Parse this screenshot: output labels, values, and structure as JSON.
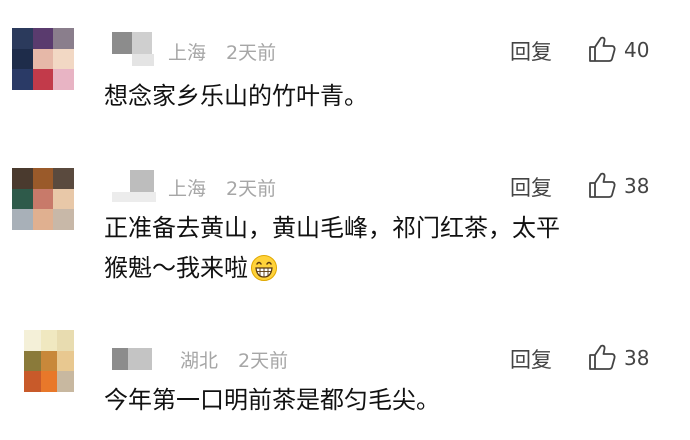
{
  "comments": [
    {
      "location": "上海",
      "time": "2天前",
      "reply_label": "回复",
      "likes": "40",
      "text": "想念家乡乐山的竹叶青。",
      "avatar_colors": [
        "#2b3a5c",
        "#5a3b6e",
        "#8a7e8c",
        "#1e2c4a",
        "#e6b8a8",
        "#f2d8c4",
        "#2a3a66",
        "#c23a4a",
        "#e8b4c4"
      ]
    },
    {
      "location": "上海",
      "time": "2天前",
      "reply_label": "回复",
      "likes": "38",
      "text_line1": "正准备去黄山，黄山毛峰，祁门红茶，太平",
      "text_line2": "猴魁～我来啦",
      "emoji": "grinning-face",
      "avatar_colors": [
        "#4a3a2e",
        "#9a5a2a",
        "#5a4a3e",
        "#2e5a4a",
        "#c87a6a",
        "#e8c8a8",
        "#a8b0b8",
        "#e0b090",
        "#c8b8a8"
      ]
    },
    {
      "location": "湖北",
      "time": "2天前",
      "reply_label": "回复",
      "likes": "38",
      "text": "今年第一口明前茶是都匀毛尖。",
      "avatar_colors": [
        "#f4f0d8",
        "#f0e8c0",
        "#e8dcb0",
        "#8a7a3a",
        "#c8883a",
        "#e8c890",
        "#c85a2a",
        "#e8782a",
        "#c8b8a0"
      ]
    }
  ]
}
